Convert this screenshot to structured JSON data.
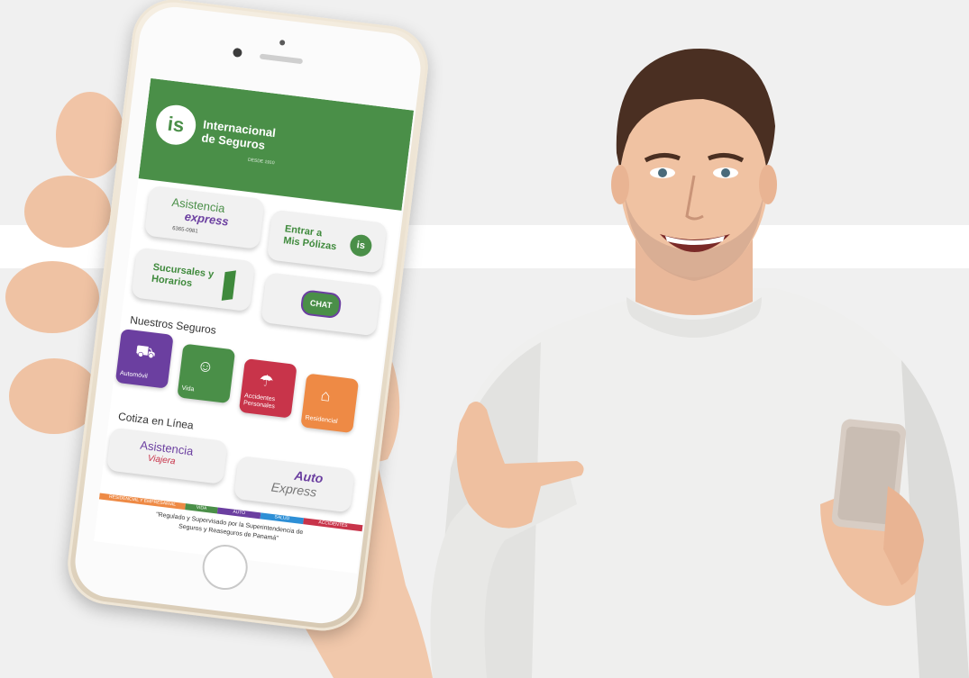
{
  "app": {
    "logo_letters": "is",
    "brand_line1": "Internacional",
    "brand_line2": "de Seguros",
    "brand_sub": "DESDE 1910"
  },
  "tiles": {
    "asistencia_express_1": "Asistencia",
    "asistencia_express_2": "express",
    "asistencia_phone": "6365-0981",
    "entrar_line1": "Entrar a",
    "entrar_line2": "Mis Pólizas",
    "sucursales_line1": "Sucursales y",
    "sucursales_line2": "Horarios",
    "chat": "CHAT"
  },
  "nuestros_seguros": {
    "title": "Nuestros Seguros",
    "items": [
      {
        "label": "Automóvil",
        "color": "#6b3fa0"
      },
      {
        "label": "Vida",
        "color": "#4a8f48"
      },
      {
        "label": "Accidentes Personales",
        "color": "#c8344a"
      },
      {
        "label": "Residencial",
        "color": "#ee8a45"
      }
    ]
  },
  "cotiza": {
    "title": "Cotiza en Línea",
    "viajera_1": "Asistencia",
    "viajera_2": "Viajera",
    "auto_1": "Auto",
    "auto_2": "Express"
  },
  "strip": [
    {
      "label": "RESIDENCIAL Y EMPRESARIAL",
      "color": "#ee8a45"
    },
    {
      "label": "VIDA",
      "color": "#4a8f48"
    },
    {
      "label": "AUTO",
      "color": "#6b3fa0"
    },
    {
      "label": "SALUD",
      "color": "#2d8fd6"
    },
    {
      "label": "ACCIDENTES",
      "color": "#c8344a"
    }
  ],
  "footer": {
    "line1": "\"Regulado y Supervisado por la Superintendencia de",
    "line2": "Seguros y Reaseguros de Panamá\""
  }
}
